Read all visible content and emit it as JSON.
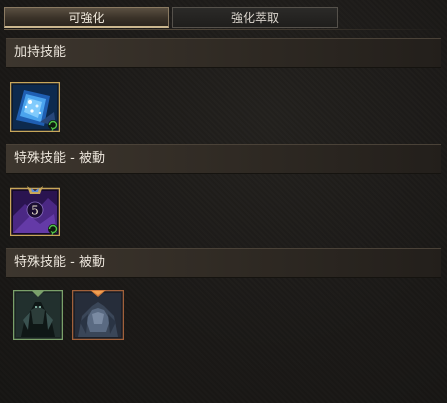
{
  "tabs": [
    {
      "label": "可強化",
      "active": true
    },
    {
      "label": "強化萃取",
      "active": false
    }
  ],
  "sections": [
    {
      "title": "加持技能",
      "skills": [
        {
          "icon": "blue-crystal-skill-icon",
          "badge": "refresh-icon"
        }
      ]
    },
    {
      "title": "特殊技能 - 被動",
      "skills": [
        {
          "icon": "purple-rune-skill-icon",
          "level": "5",
          "badge": "refresh-icon"
        }
      ]
    },
    {
      "title": "特殊技能 - 被動",
      "skills": [
        {
          "icon": "shadow-warrior-skill-icon"
        },
        {
          "icon": "armored-warrior-skill-icon"
        }
      ]
    }
  ],
  "colors": {
    "accent": "#cbb78f",
    "refresh": "#4fc24a",
    "frame_gold": "#c8a65a",
    "frame_bronze": "#a0603a"
  }
}
